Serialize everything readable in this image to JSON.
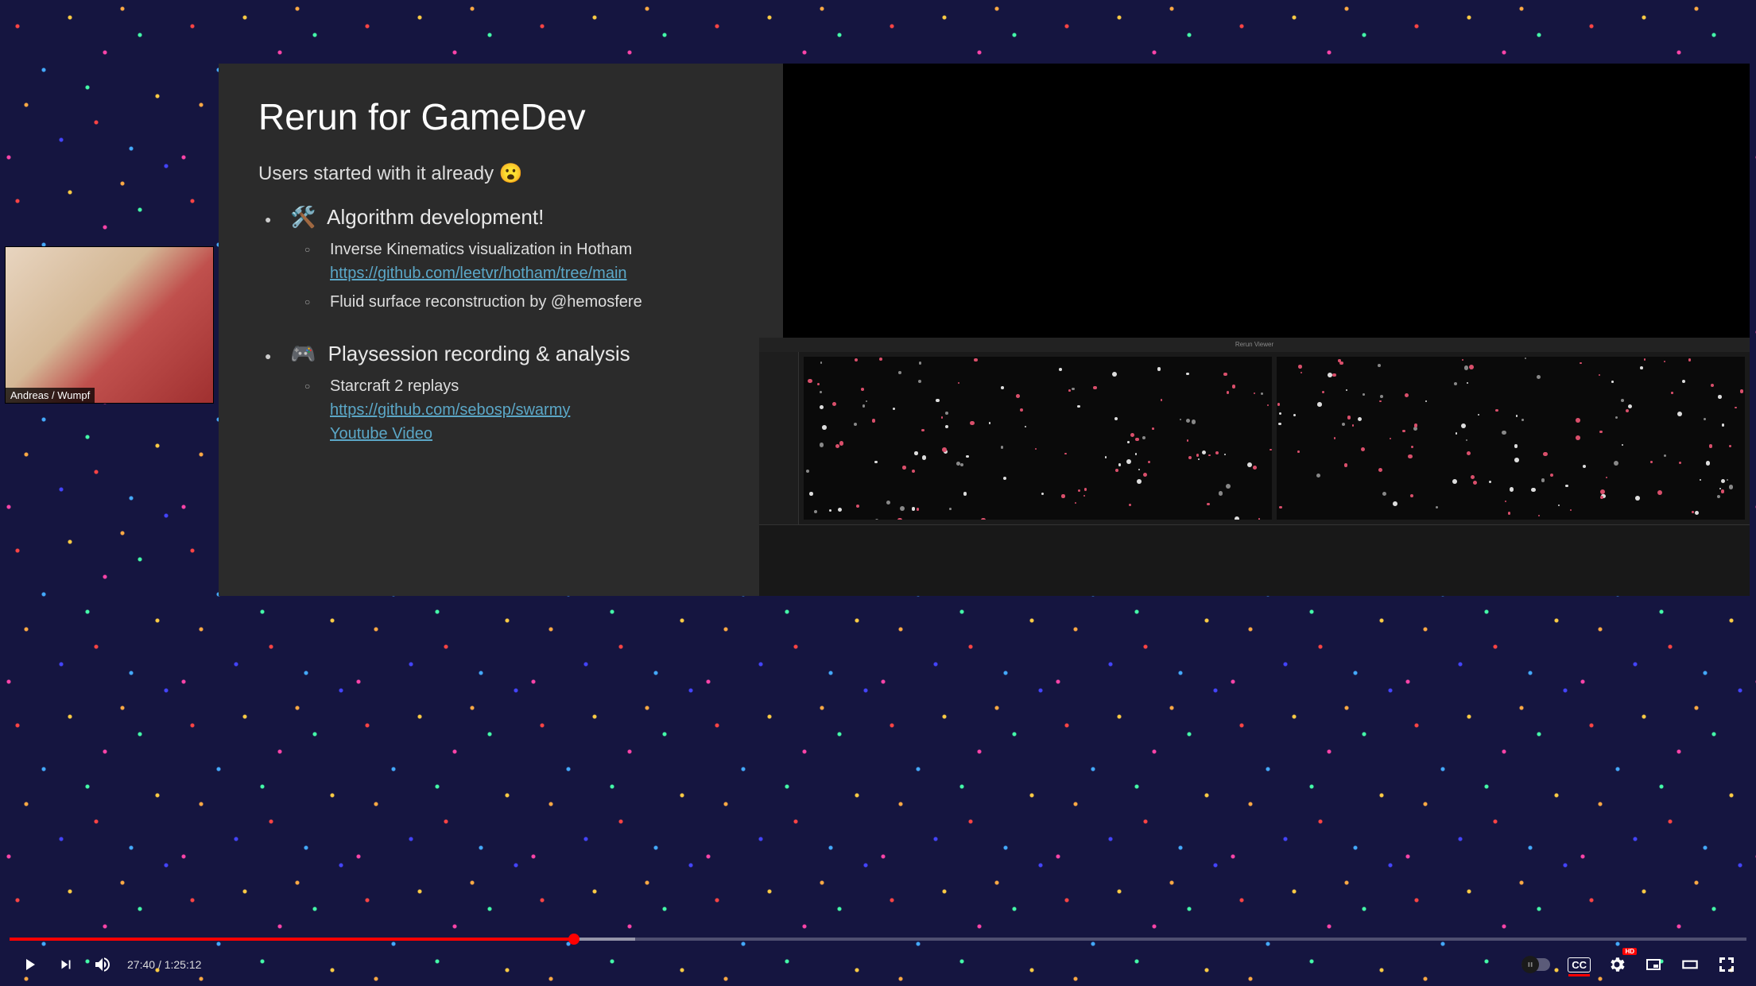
{
  "webcam": {
    "label": "Andreas / Wumpf"
  },
  "slide": {
    "title": "Rerun for GameDev",
    "subtitle": "Users started with it already 😮",
    "bullets": [
      {
        "icon": "🛠️",
        "head": "Algorithm development!",
        "sub": [
          {
            "text": "Inverse Kinematics visualization in Hotham",
            "link_text": "https://github.com/leetvr/hotham/tree/main"
          },
          {
            "text": "Fluid surface reconstruction by @hemosfere"
          }
        ]
      },
      {
        "icon": "🎮",
        "head": "Playsession recording & analysis",
        "sub": [
          {
            "text": "Starcraft 2 replays",
            "link_text": "https://github.com/sebosp/swarmy",
            "link2_text": "Youtube Video"
          }
        ]
      }
    ]
  },
  "viz": {
    "title": "Rerun Viewer"
  },
  "player": {
    "current_time": "27:40",
    "duration": "1:25:12",
    "progress_played_pct": 32.5,
    "progress_loaded_pct": 36,
    "cc_label": "CC",
    "hd_label": "HD"
  }
}
